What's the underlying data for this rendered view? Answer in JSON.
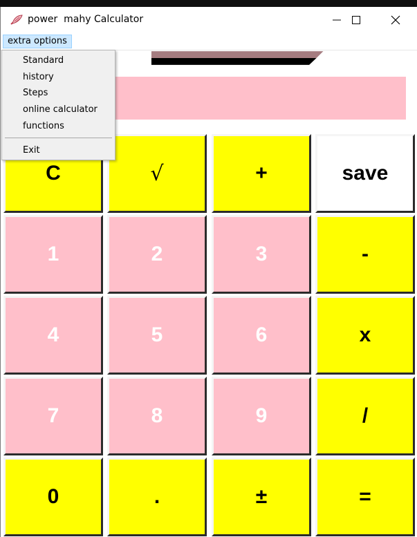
{
  "window": {
    "title": "power  mahy Calculator",
    "controls": [
      "minimize",
      "maximize",
      "close"
    ]
  },
  "menubar": {
    "extra_options_label": "extra options"
  },
  "dropdown": {
    "items": [
      {
        "label": "Standard"
      },
      {
        "label": "history"
      },
      {
        "label": "Steps"
      },
      {
        "label": "online calculator"
      },
      {
        "label": "functions"
      },
      {
        "label": "Exit"
      }
    ]
  },
  "display": {
    "value": ""
  },
  "keypad": {
    "rows": [
      [
        {
          "label": "C",
          "color": "yellow"
        },
        {
          "label": "√",
          "color": "yellow"
        },
        {
          "label": "+",
          "color": "yellow"
        },
        {
          "label": "save",
          "color": "white"
        }
      ],
      [
        {
          "label": "1",
          "color": "pink"
        },
        {
          "label": "2",
          "color": "pink"
        },
        {
          "label": "3",
          "color": "pink"
        },
        {
          "label": "-",
          "color": "yellow"
        }
      ],
      [
        {
          "label": "4",
          "color": "pink"
        },
        {
          "label": "5",
          "color": "pink"
        },
        {
          "label": "6",
          "color": "pink"
        },
        {
          "label": "x",
          "color": "yellow"
        }
      ],
      [
        {
          "label": "7",
          "color": "pink"
        },
        {
          "label": "8",
          "color": "pink"
        },
        {
          "label": "9",
          "color": "pink"
        },
        {
          "label": "/",
          "color": "yellow"
        }
      ],
      [
        {
          "label": "0",
          "color": "yellow"
        },
        {
          "label": ".",
          "color": "yellow"
        },
        {
          "label": "±",
          "color": "yellow"
        },
        {
          "label": "=",
          "color": "yellow"
        }
      ]
    ]
  },
  "colors": {
    "yellow": "#ffff00",
    "pink": "#ffbfca",
    "menu_highlight": "#cce8ff",
    "display_stripe": "#a57c80"
  }
}
